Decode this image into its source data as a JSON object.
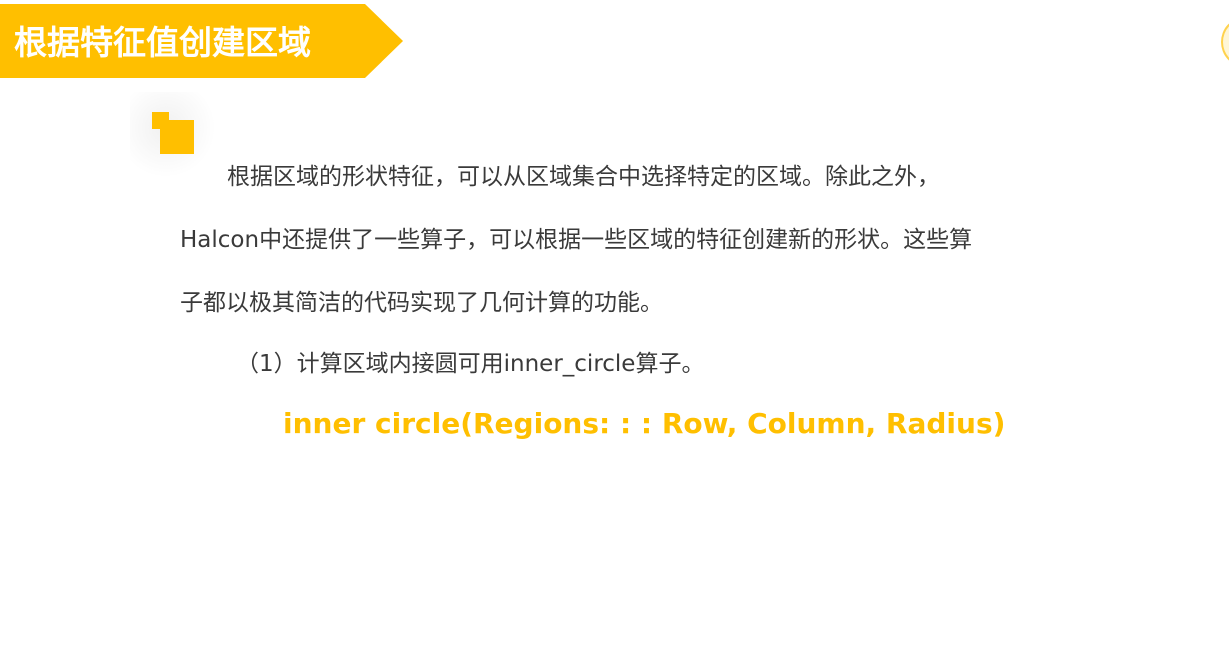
{
  "title": "根据特征值创建区域",
  "paragraphs": [
    "根据区域的形状特征，可以从区域集合中选择特定的区域。除此之外，",
    "Halcon中还提供了一些算子，可以根据一些区域的特征创建新的形状。这些算",
    "子都以极其简洁的代码实现了几何计算的功能。",
    "（1）计算区域内接圆可用inner_circle算子。"
  ],
  "formula": "inner circle(Regions: : : Row, Column, Radius)",
  "colors": {
    "accent": "#ffbf00",
    "text": "#3a3a3a",
    "background": "#ffffff"
  }
}
